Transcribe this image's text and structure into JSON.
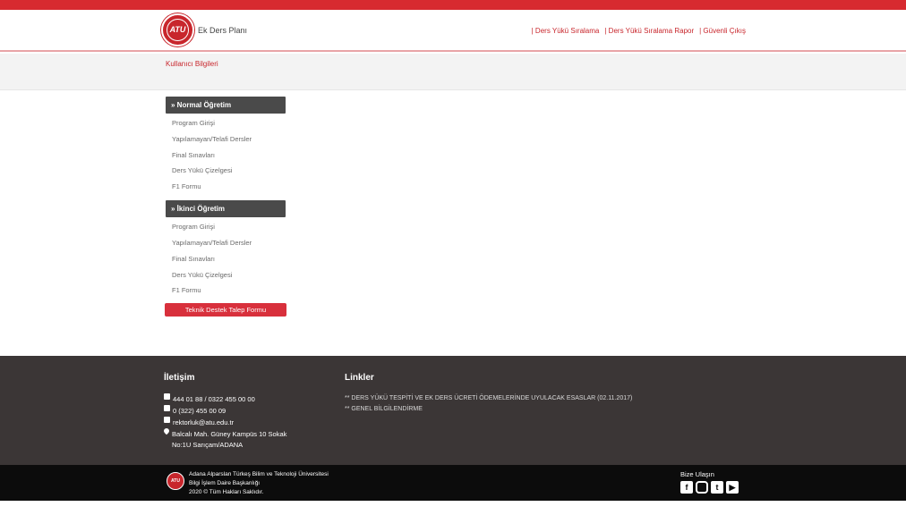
{
  "header": {
    "logo_text": "ATU",
    "app_title": "Ek Ders Planı",
    "nav": [
      "| Ders Yükü Sıralama",
      "| Ders Yükü Sıralama Rapor",
      "| Güvenli Çıkış"
    ]
  },
  "subheader": {
    "title": "Kullanıcı Bilgileri"
  },
  "sidebar": {
    "sections": [
      {
        "title": "» Normal Öğretim",
        "items": [
          "Program Girişi",
          "Yapılamayan/Telafi Dersler",
          "Final Sınavları",
          "Ders Yükü Çizelgesi",
          "F1 Formu"
        ]
      },
      {
        "title": "» İkinci Öğretim",
        "items": [
          "Program Girişi",
          "Yapılamayan/Telafi Dersler",
          "Final Sınavları",
          "Ders Yükü Çizelgesi",
          "F1 Formu"
        ]
      }
    ],
    "support_button": "Teknik Destek Talep Formu"
  },
  "footer": {
    "contact_title": "İletişim",
    "phone": "444 01 88  / 0322 455 00 00",
    "fax": "0 (322) 455 00 09",
    "email": "rektorluk@atu.edu.tr",
    "address_line1": "Balcalı Mah. Güney Kampüs 10 Sokak",
    "address_line2": "No:1U Sarıçam/ADANA",
    "links_title": "Linkler",
    "links": [
      "** DERS YÜKÜ TESPİTİ VE EK DERS ÜCRETİ ÖDEMELERİNDE UYULACAK ESASLAR (02.11.2017)",
      "** GENEL BİLGİLENDİRME"
    ]
  },
  "bottom": {
    "logo_text": "ATU",
    "line1": "Adana Alparslan Türkeş Bilim ve Teknoloji Üniversitesi",
    "line2": "Bilgi İşlem Daire Başkanlığı",
    "line3": "2020 © Tüm Hakları Saklıdır.",
    "social_title": "Bize Ulaşın",
    "social_icons": [
      "facebook-icon",
      "instagram-icon",
      "twitter-icon",
      "youtube-icon"
    ]
  },
  "colors": {
    "accent": "#c8262c",
    "menu_head": "#4a4a4a",
    "footer": "#3b3636",
    "bottom": "#0c0c0c"
  }
}
